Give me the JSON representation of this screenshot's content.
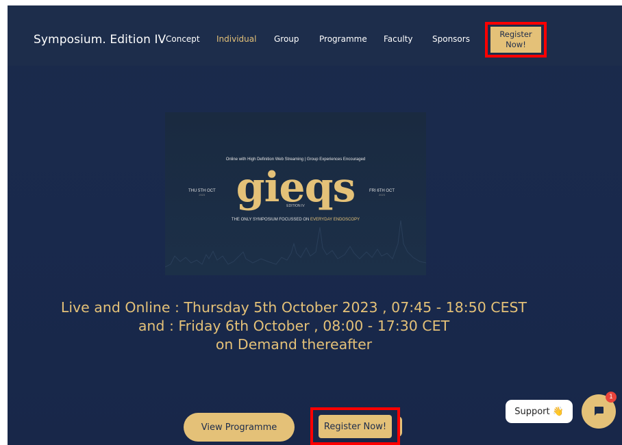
{
  "nav": {
    "brand": "Symposium. Edition IV",
    "links": [
      "Concept",
      "Individual",
      "Group",
      "Programme",
      "Faculty",
      "Sponsors"
    ],
    "active": "Individual",
    "register_line1": "Register",
    "register_line2": "Now!"
  },
  "hero": {
    "tagline": "Online with High Definition Web Streaming | Group Experiences Encouraged",
    "logo": "gieqs",
    "edition": "EDITION IV",
    "date_left": "THU 5TH OCT",
    "date_left_year": "2023",
    "date_right": "FRI 6TH OCT",
    "date_right_year": "2023",
    "subtitle_prefix": "THE ONLY SYMPOSIUM FOCUSSED ON ",
    "subtitle_highlight": "EVERYDAY ENDOSCOPY"
  },
  "event": {
    "line1": "Live and Online : Thursday 5th October 2023 , 07:45 - 18:50 CEST",
    "line2": "and : Friday 6th October , 08:00 - 17:30 CET",
    "line3": "on Demand thereafter"
  },
  "buttons": {
    "view_programme": "View Programme",
    "register_now": "Register Now!"
  },
  "widgets": {
    "support_label": "Support",
    "support_emoji": "👋",
    "chat_badge": "1"
  },
  "colors": {
    "background": "#1b2b4b",
    "accent_gold": "#e4c178",
    "highlight_red": "#ff0000",
    "badge_red": "#e8443b"
  }
}
